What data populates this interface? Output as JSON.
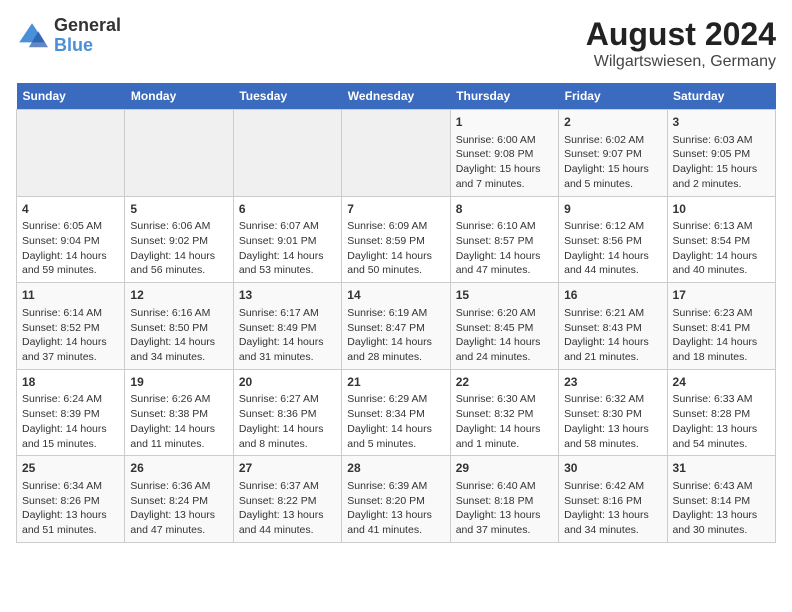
{
  "logo": {
    "text_general": "General",
    "text_blue": "Blue"
  },
  "title": "August 2024",
  "subtitle": "Wilgartswiesen, Germany",
  "days_of_week": [
    "Sunday",
    "Monday",
    "Tuesday",
    "Wednesday",
    "Thursday",
    "Friday",
    "Saturday"
  ],
  "weeks": [
    [
      {
        "day": "",
        "info": ""
      },
      {
        "day": "",
        "info": ""
      },
      {
        "day": "",
        "info": ""
      },
      {
        "day": "",
        "info": ""
      },
      {
        "day": "1",
        "info": "Sunrise: 6:00 AM\nSunset: 9:08 PM\nDaylight: 15 hours\nand 7 minutes."
      },
      {
        "day": "2",
        "info": "Sunrise: 6:02 AM\nSunset: 9:07 PM\nDaylight: 15 hours\nand 5 minutes."
      },
      {
        "day": "3",
        "info": "Sunrise: 6:03 AM\nSunset: 9:05 PM\nDaylight: 15 hours\nand 2 minutes."
      }
    ],
    [
      {
        "day": "4",
        "info": "Sunrise: 6:05 AM\nSunset: 9:04 PM\nDaylight: 14 hours\nand 59 minutes."
      },
      {
        "day": "5",
        "info": "Sunrise: 6:06 AM\nSunset: 9:02 PM\nDaylight: 14 hours\nand 56 minutes."
      },
      {
        "day": "6",
        "info": "Sunrise: 6:07 AM\nSunset: 9:01 PM\nDaylight: 14 hours\nand 53 minutes."
      },
      {
        "day": "7",
        "info": "Sunrise: 6:09 AM\nSunset: 8:59 PM\nDaylight: 14 hours\nand 50 minutes."
      },
      {
        "day": "8",
        "info": "Sunrise: 6:10 AM\nSunset: 8:57 PM\nDaylight: 14 hours\nand 47 minutes."
      },
      {
        "day": "9",
        "info": "Sunrise: 6:12 AM\nSunset: 8:56 PM\nDaylight: 14 hours\nand 44 minutes."
      },
      {
        "day": "10",
        "info": "Sunrise: 6:13 AM\nSunset: 8:54 PM\nDaylight: 14 hours\nand 40 minutes."
      }
    ],
    [
      {
        "day": "11",
        "info": "Sunrise: 6:14 AM\nSunset: 8:52 PM\nDaylight: 14 hours\nand 37 minutes."
      },
      {
        "day": "12",
        "info": "Sunrise: 6:16 AM\nSunset: 8:50 PM\nDaylight: 14 hours\nand 34 minutes."
      },
      {
        "day": "13",
        "info": "Sunrise: 6:17 AM\nSunset: 8:49 PM\nDaylight: 14 hours\nand 31 minutes."
      },
      {
        "day": "14",
        "info": "Sunrise: 6:19 AM\nSunset: 8:47 PM\nDaylight: 14 hours\nand 28 minutes."
      },
      {
        "day": "15",
        "info": "Sunrise: 6:20 AM\nSunset: 8:45 PM\nDaylight: 14 hours\nand 24 minutes."
      },
      {
        "day": "16",
        "info": "Sunrise: 6:21 AM\nSunset: 8:43 PM\nDaylight: 14 hours\nand 21 minutes."
      },
      {
        "day": "17",
        "info": "Sunrise: 6:23 AM\nSunset: 8:41 PM\nDaylight: 14 hours\nand 18 minutes."
      }
    ],
    [
      {
        "day": "18",
        "info": "Sunrise: 6:24 AM\nSunset: 8:39 PM\nDaylight: 14 hours\nand 15 minutes."
      },
      {
        "day": "19",
        "info": "Sunrise: 6:26 AM\nSunset: 8:38 PM\nDaylight: 14 hours\nand 11 minutes."
      },
      {
        "day": "20",
        "info": "Sunrise: 6:27 AM\nSunset: 8:36 PM\nDaylight: 14 hours\nand 8 minutes."
      },
      {
        "day": "21",
        "info": "Sunrise: 6:29 AM\nSunset: 8:34 PM\nDaylight: 14 hours\nand 5 minutes."
      },
      {
        "day": "22",
        "info": "Sunrise: 6:30 AM\nSunset: 8:32 PM\nDaylight: 14 hours\nand 1 minute."
      },
      {
        "day": "23",
        "info": "Sunrise: 6:32 AM\nSunset: 8:30 PM\nDaylight: 13 hours\nand 58 minutes."
      },
      {
        "day": "24",
        "info": "Sunrise: 6:33 AM\nSunset: 8:28 PM\nDaylight: 13 hours\nand 54 minutes."
      }
    ],
    [
      {
        "day": "25",
        "info": "Sunrise: 6:34 AM\nSunset: 8:26 PM\nDaylight: 13 hours\nand 51 minutes."
      },
      {
        "day": "26",
        "info": "Sunrise: 6:36 AM\nSunset: 8:24 PM\nDaylight: 13 hours\nand 47 minutes."
      },
      {
        "day": "27",
        "info": "Sunrise: 6:37 AM\nSunset: 8:22 PM\nDaylight: 13 hours\nand 44 minutes."
      },
      {
        "day": "28",
        "info": "Sunrise: 6:39 AM\nSunset: 8:20 PM\nDaylight: 13 hours\nand 41 minutes."
      },
      {
        "day": "29",
        "info": "Sunrise: 6:40 AM\nSunset: 8:18 PM\nDaylight: 13 hours\nand 37 minutes."
      },
      {
        "day": "30",
        "info": "Sunrise: 6:42 AM\nSunset: 8:16 PM\nDaylight: 13 hours\nand 34 minutes."
      },
      {
        "day": "31",
        "info": "Sunrise: 6:43 AM\nSunset: 8:14 PM\nDaylight: 13 hours\nand 30 minutes."
      }
    ]
  ]
}
